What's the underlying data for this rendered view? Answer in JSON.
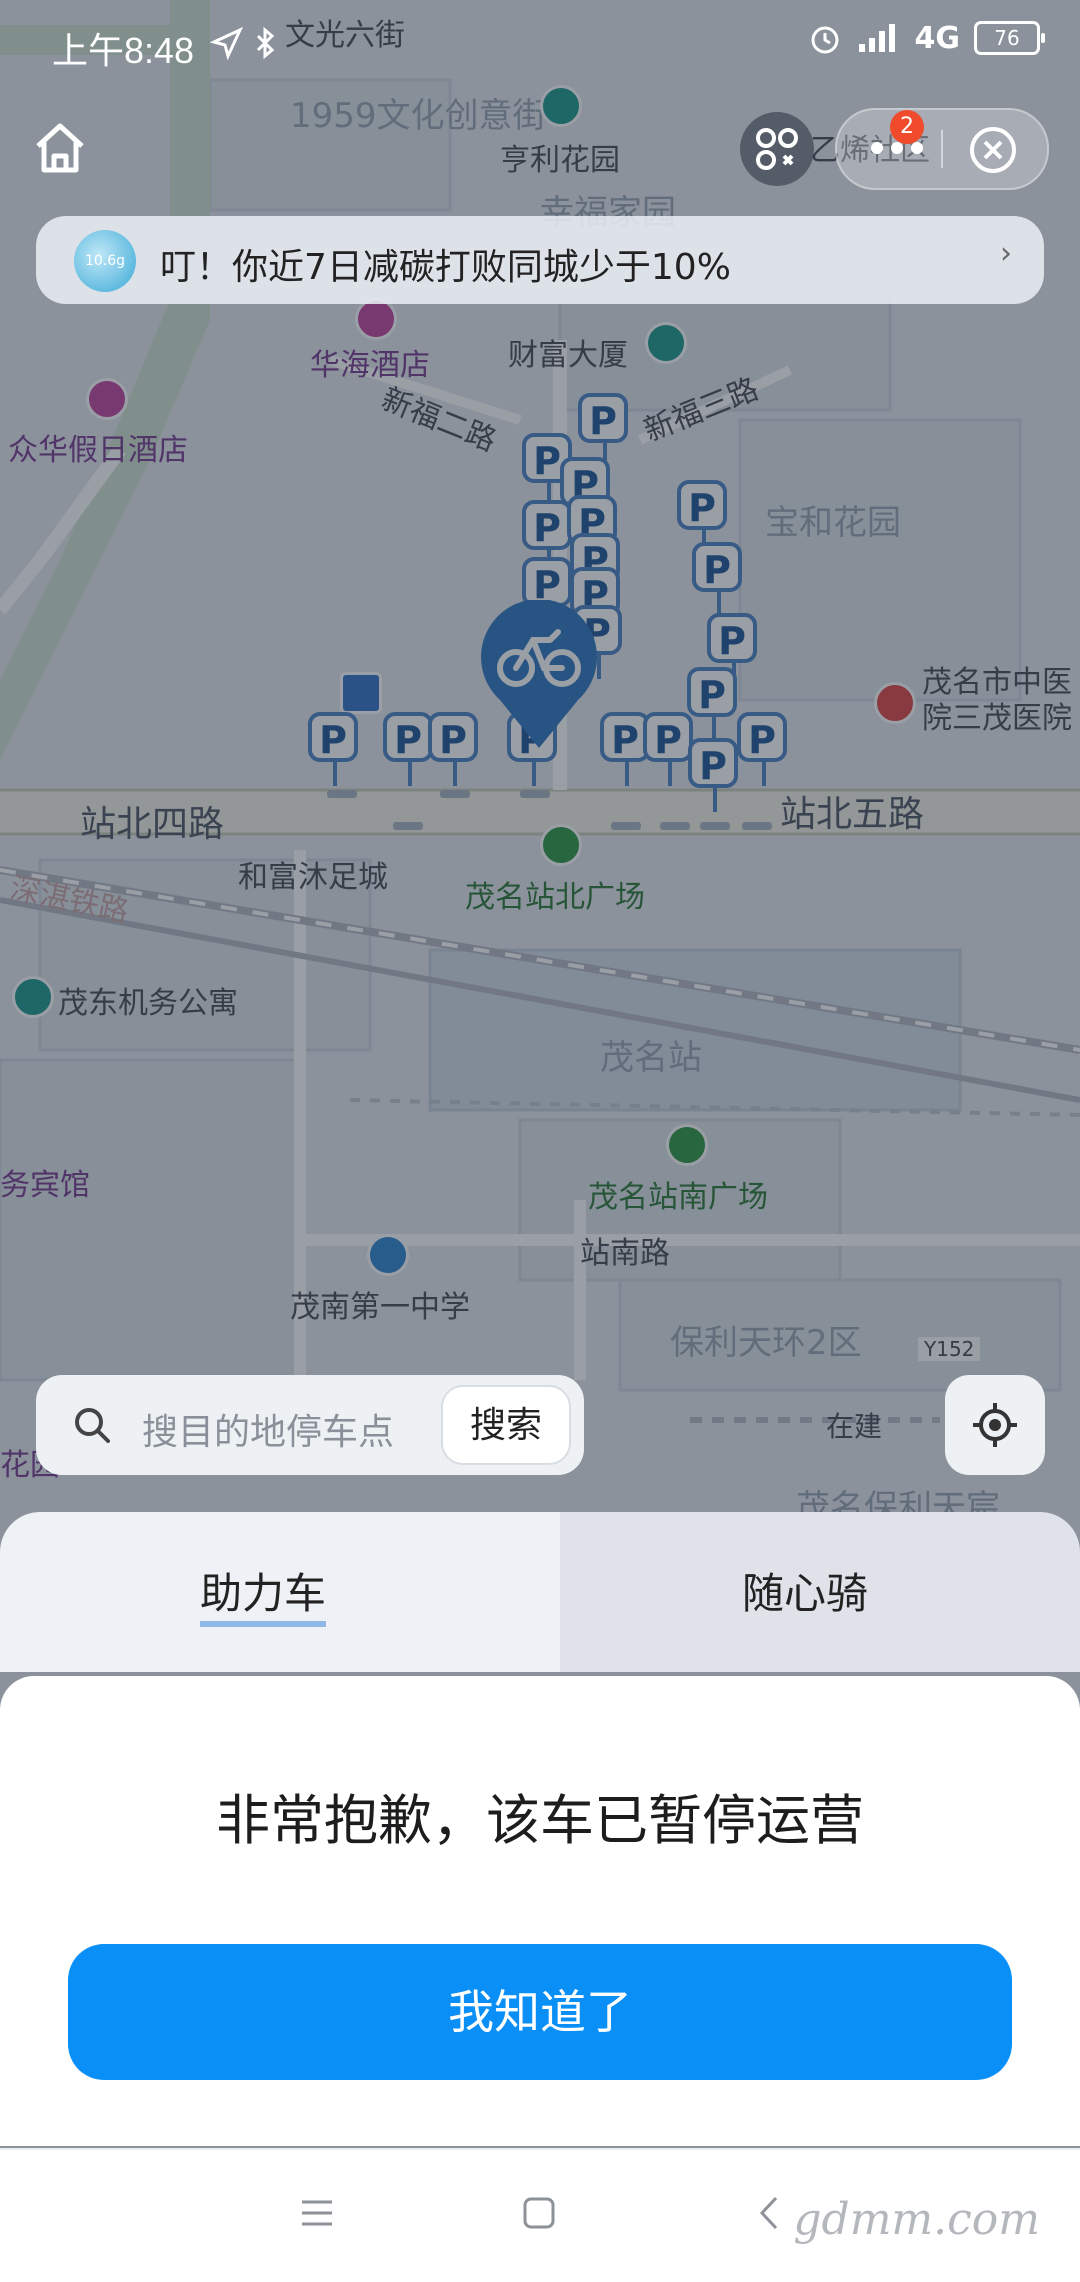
{
  "status_bar": {
    "time": "上午8:48",
    "network": "4G",
    "battery": "76"
  },
  "banner": {
    "badge_text": "10.6g",
    "text": "叮！你近7日减碳打败同城少于10%"
  },
  "capsule": {
    "badge_count": "2"
  },
  "map": {
    "labels": {
      "wenguang": "文光六街",
      "culture": "1959文化创意街",
      "hengli": "亨利花园",
      "xingfu_jia": "幸福家园",
      "yixi": "乙烯社区",
      "huahai": "华海酒店",
      "caifu": "财富大厦",
      "xinfu2": "新福二路",
      "xinfu3": "新福三路",
      "zhonghua": "众华假日酒店",
      "baohe": "宝和花园",
      "hospital": "茂名市中医院三茂医院",
      "zhanbei4": "站北四路",
      "zhanbei5": "站北五路",
      "hefu": "和富沐足城",
      "zhanbei_square": "茂名站北广场",
      "shenzhan_rail": "深湛铁路",
      "maodong": "茂东机务公寓",
      "station": "茂名站",
      "wubinguan": "务宾馆",
      "zhannan_square": "茂名站南广场",
      "zhannan_road": "站南路",
      "maonan_school": "茂南第一中学",
      "baoli_tianhuan": "保利天环2区",
      "y152": "Y152",
      "zaijian": "在建",
      "huayuan": "花园",
      "baoli_tianchen": "茂名保利天宸"
    }
  },
  "search": {
    "placeholder": "搜目的地停车点",
    "button": "搜索"
  },
  "tabs": {
    "assist": "助力车",
    "free_ride": "随心骑"
  },
  "dialog": {
    "message": "非常抱歉，该车已暂停运营",
    "confirm": "我知道了"
  },
  "watermark": "gdmm.com",
  "colors": {
    "primary": "#0a8ff6",
    "parking": "#4e86c7",
    "badge": "#f04b2d"
  }
}
